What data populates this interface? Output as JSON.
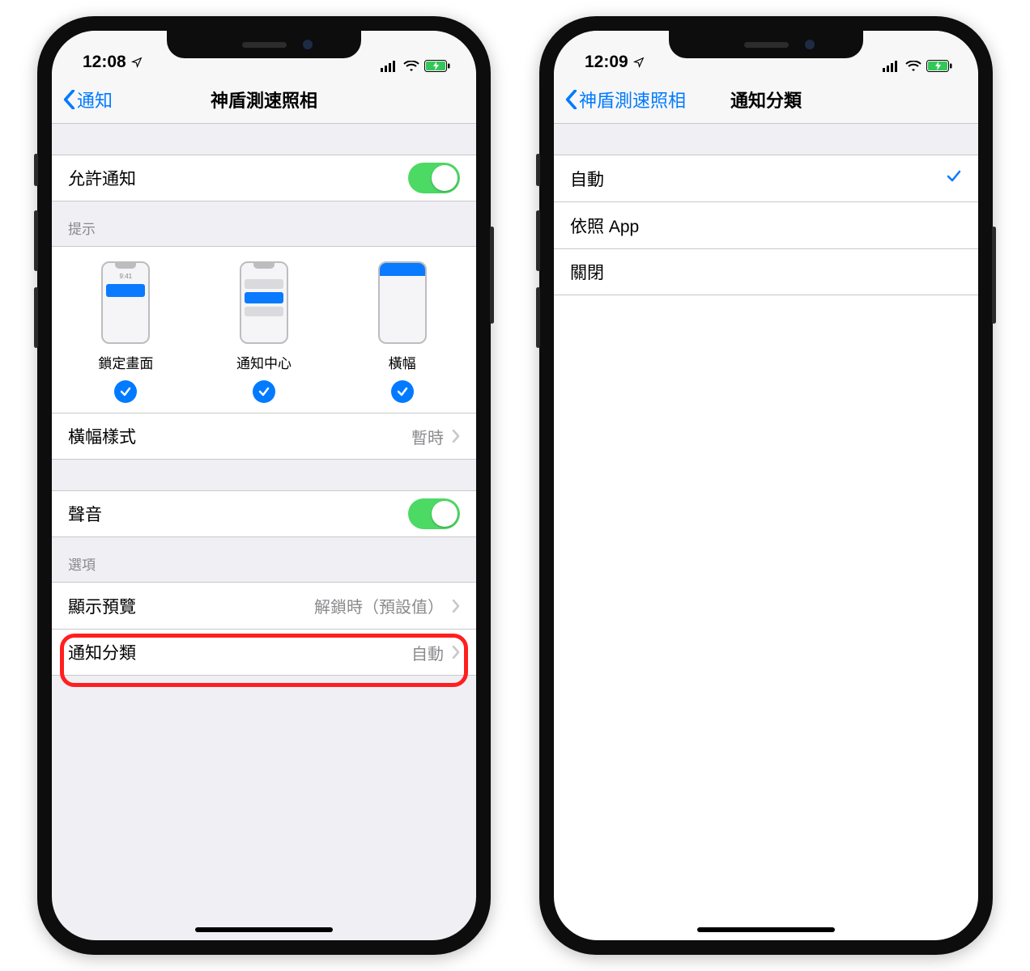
{
  "phones": [
    {
      "status": {
        "time": "12:08",
        "loc_icon": "location",
        "cell_icon": "signal",
        "wifi_icon": "wifi",
        "batt_icon": "battery-charging"
      },
      "nav": {
        "back_label": "通知",
        "title": "神盾測速照相"
      },
      "allow_notifications_label": "允許通知",
      "alerts_header": "提示",
      "alert_options": {
        "lock_label": "鎖定畫面",
        "center_label": "通知中心",
        "banner_label": "橫幅",
        "lock_time": "9:41"
      },
      "banner_style_row": {
        "label": "橫幅樣式",
        "value": "暫時"
      },
      "sound_label": "聲音",
      "options_header": "選項",
      "preview_row": {
        "label": "顯示預覽",
        "value": "解鎖時（預設值）"
      },
      "grouping_row": {
        "label": "通知分類",
        "value": "自動"
      }
    },
    {
      "status": {
        "time": "12:09",
        "loc_icon": "location",
        "cell_icon": "signal",
        "wifi_icon": "wifi",
        "batt_icon": "battery-charging"
      },
      "nav": {
        "back_label": "神盾測速照相",
        "title": "通知分類"
      },
      "grouping_options": {
        "auto": "自動",
        "by_app": "依照 App",
        "off": "關閉"
      },
      "selected": "auto"
    }
  ]
}
